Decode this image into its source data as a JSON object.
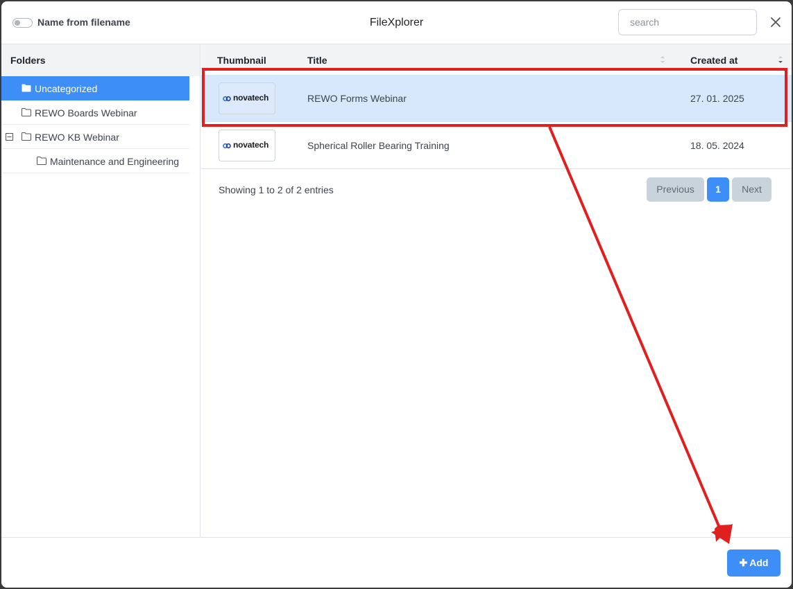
{
  "header": {
    "toggle_label": "Name from filename",
    "title": "FileXplorer",
    "search_placeholder": "search"
  },
  "sidebar": {
    "heading": "Folders",
    "items": [
      {
        "label": "Uncategorized",
        "active": true
      },
      {
        "label": "REWO Boards Webinar"
      },
      {
        "label": "REWO KB Webinar",
        "expanded": true
      },
      {
        "label": "Maintenance and Engineering",
        "nested": true
      }
    ]
  },
  "table": {
    "columns": [
      "Thumbnail",
      "Title",
      "Created at"
    ],
    "rows": [
      {
        "thumbnail_text": "novatech",
        "title": "REWO Forms Webinar",
        "created_at": "27. 01. 2025",
        "selected": true
      },
      {
        "thumbnail_text": "novatech",
        "title": "Spherical Roller Bearing Training",
        "created_at": "18. 05. 2024"
      }
    ],
    "info": "Showing 1 to 2 of 2 entries",
    "pagination": {
      "previous": "Previous",
      "current": "1",
      "next": "Next"
    }
  },
  "footer": {
    "add_label": "Add"
  },
  "colors": {
    "accent": "#3e8ef7",
    "selected_row": "#d7e8fd",
    "annotation": "#e0201e"
  }
}
